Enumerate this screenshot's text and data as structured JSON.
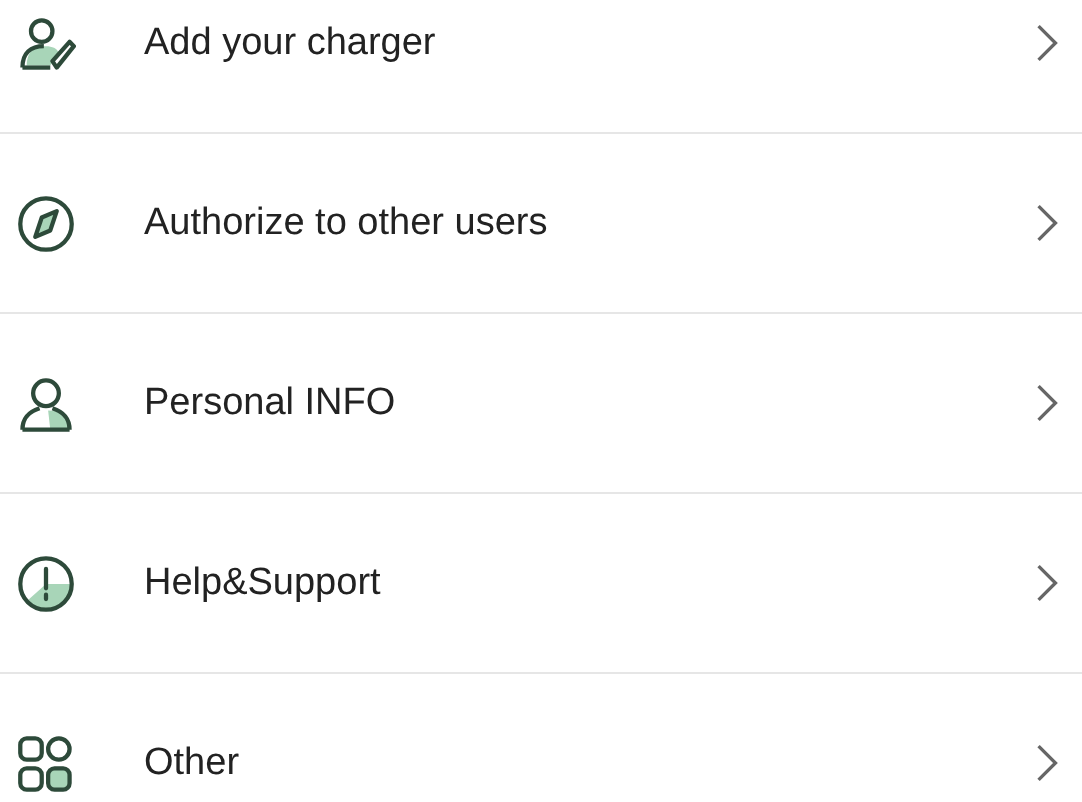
{
  "menu": [
    {
      "label": "Add your charger",
      "kind": "add"
    },
    {
      "label": "Authorize to other users",
      "kind": "authorize"
    },
    {
      "label": "Personal INFO",
      "kind": "personal"
    },
    {
      "label": "Help&Support",
      "kind": "help"
    },
    {
      "label": "Other",
      "kind": "other"
    }
  ]
}
